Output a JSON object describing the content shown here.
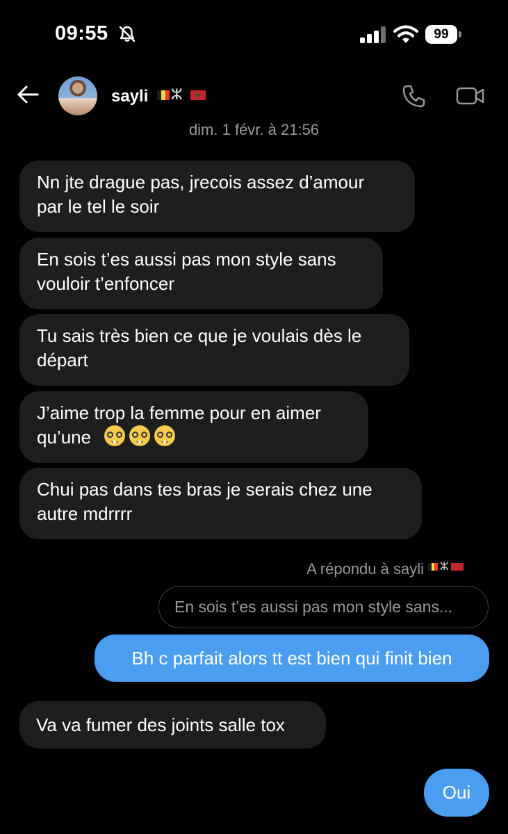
{
  "status_bar": {
    "time": "09:55",
    "battery": "99"
  },
  "header": {
    "contact_name": "sayli",
    "name_symbol": "ⵣ"
  },
  "timestamp": "dim. 1 févr. à 21:56",
  "messages_in": [
    {
      "line1": "Nn jte drague pas, jrecois assez d’amour",
      "line2": "par le tel le soir"
    },
    {
      "line1": "En sois t’es aussi pas mon style sans",
      "line2": "vouloir t’enfoncer"
    },
    {
      "line1": "Tu sais très bien ce que je voulais dès le",
      "line2": "départ"
    },
    {
      "line1": "J’aime trop la femme pour en aimer",
      "line2": "qu’une"
    },
    {
      "line1": "Chui pas dans tes bras je serais chez une",
      "line2": "autre mdrrrr"
    }
  ],
  "reply": {
    "label": "A répondu à sayli",
    "symbol": "ⵣ",
    "quoted": "En sois t’es aussi pas mon style sans..."
  },
  "outgoing_1": "Bh c parfait alors tt est bien qui finit bien",
  "incoming_last": "Va va fumer des joints salle tox",
  "outgoing_2": "Oui",
  "colors": {
    "outgoing_bubble": "#4b9df0",
    "incoming_bubble": "#1e1e1e",
    "background": "#000000"
  }
}
